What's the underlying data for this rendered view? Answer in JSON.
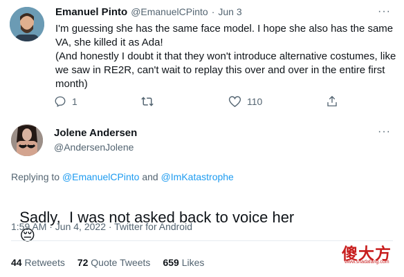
{
  "reply_tweet": {
    "author_name": "Emanuel Pinto",
    "handle": "@EmanuelCPinto",
    "separator": "·",
    "date": "Jun 3",
    "more": "···",
    "lines": [
      "I'm guessing she has the same face model. I hope she also has the same",
      "VA, she killed it as Ada!",
      "(And honestly I doubt it that they won't introduce alternative costumes, like",
      "we saw in RE2R, can't wait to replay this over and over in the entire first",
      "month)"
    ],
    "actions": {
      "reply_count": "1",
      "retweet_count": "",
      "like_count": "110"
    }
  },
  "main_tweet": {
    "author_name": "Jolene Andersen",
    "handle": "@AndersenJolene",
    "more": "···",
    "replying_prefix": "Replying to",
    "replying_user_1": "@EmanuelCPinto",
    "replying_and": "and",
    "replying_user_2": "@ImKatastrophe",
    "text": "Sadly,  I was not asked back to voice her",
    "emoji": "😔",
    "meta": "1:59 AM · Jun 4, 2022 · Twitter for Android"
  },
  "stats": {
    "retweets_count": "44",
    "retweets_label": "Retweets",
    "quotes_count": "72",
    "quotes_label": "Quote Tweets",
    "likes_count": "659",
    "likes_label": "Likes"
  },
  "watermark": {
    "text": "傻大方",
    "subtext": "www.shadafang.com"
  },
  "colors": {
    "accent": "#1d9bf0",
    "text": "#0f1419",
    "muted": "#536471",
    "watermark": "#c81e1e"
  }
}
